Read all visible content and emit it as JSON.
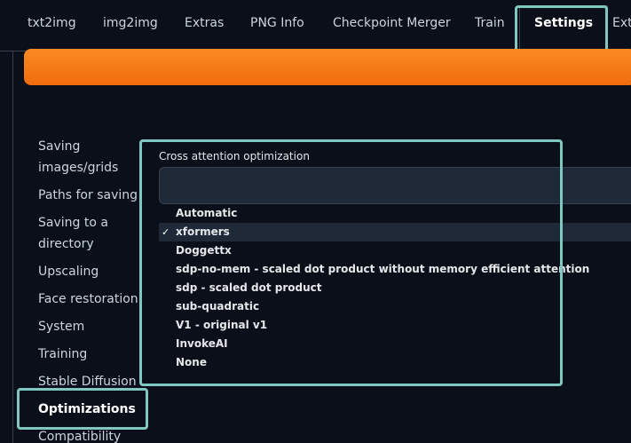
{
  "tabs": [
    {
      "label": "txt2img"
    },
    {
      "label": "img2img"
    },
    {
      "label": "Extras"
    },
    {
      "label": "PNG Info"
    },
    {
      "label": "Checkpoint Merger"
    },
    {
      "label": "Train"
    },
    {
      "label": "Settings"
    },
    {
      "label": "Ext"
    }
  ],
  "sidebar": {
    "items": [
      {
        "label": "Saving images/grids"
      },
      {
        "label": "Paths for saving"
      },
      {
        "label": "Saving to a directory"
      },
      {
        "label": "Upscaling"
      },
      {
        "label": "Face restoration"
      },
      {
        "label": "System"
      },
      {
        "label": "Training"
      },
      {
        "label": "Stable Diffusion"
      },
      {
        "label": "Optimizations"
      },
      {
        "label": "Compatibility"
      }
    ]
  },
  "setting": {
    "label": "Cross attention optimization",
    "selected": "xformers",
    "options": [
      {
        "label": "Automatic"
      },
      {
        "label": "xformers",
        "mark": "✓"
      },
      {
        "label": "Doggettx"
      },
      {
        "label": "sdp-no-mem - scaled dot product without memory efficient attention"
      },
      {
        "label": "sdp - scaled dot product"
      },
      {
        "label": "sub-quadratic"
      },
      {
        "label": "V1 - original v1"
      },
      {
        "label": "InvokeAI"
      },
      {
        "label": "None"
      }
    ]
  },
  "colors": {
    "background": "#0b0f19",
    "accent": "#f97316",
    "highlight": "#7fc8bf"
  }
}
